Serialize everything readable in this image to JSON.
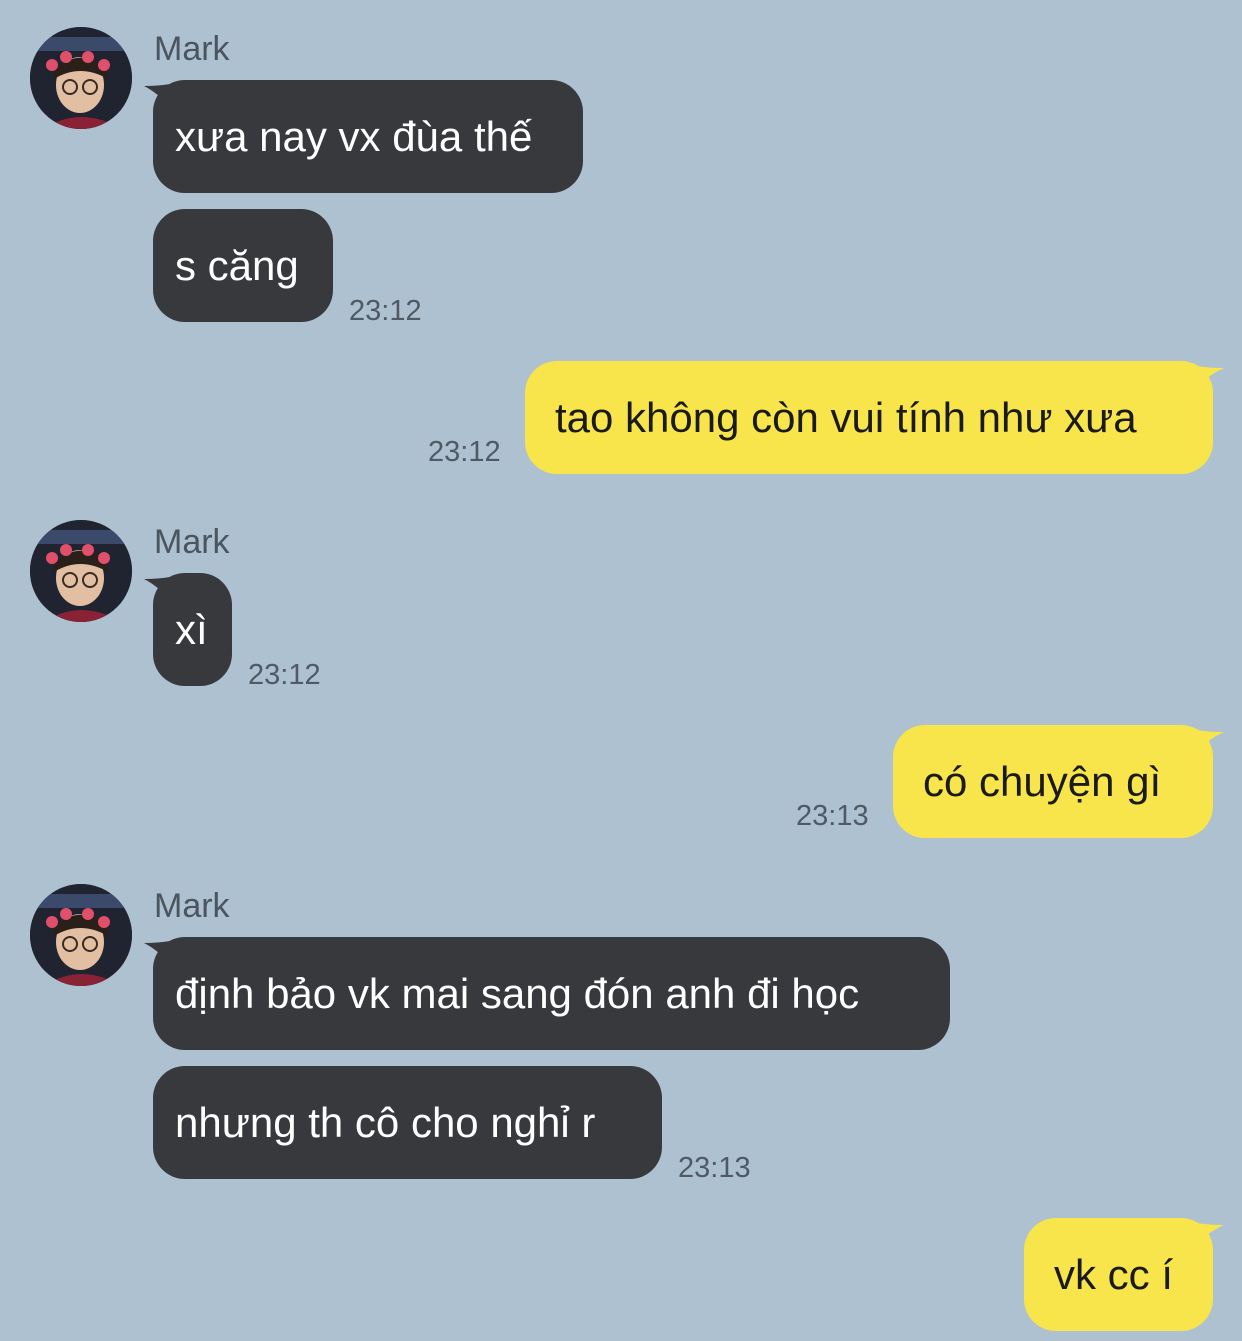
{
  "colors": {
    "background": "#adc1d1",
    "incoming_bubble": "#38393d",
    "outgoing_bubble": "#f8e54b"
  },
  "messages": [
    {
      "side": "in",
      "sender": "Mark",
      "text": "xưa nay vx đùa thế"
    },
    {
      "side": "in",
      "text": "s căng",
      "time": "23:12"
    },
    {
      "side": "out",
      "text": "tao không còn vui tính như xưa",
      "time": "23:12"
    },
    {
      "side": "in",
      "sender": "Mark",
      "text": "xì",
      "time": "23:12"
    },
    {
      "side": "out",
      "text": "có chuyện gì",
      "time": "23:13"
    },
    {
      "side": "in",
      "sender": "Mark",
      "text": "định bảo vk mai sang đón anh đi học"
    },
    {
      "side": "in",
      "text": "nhưng th cô cho nghỉ r",
      "time": "23:13"
    },
    {
      "side": "out",
      "text": "vk cc í"
    }
  ]
}
